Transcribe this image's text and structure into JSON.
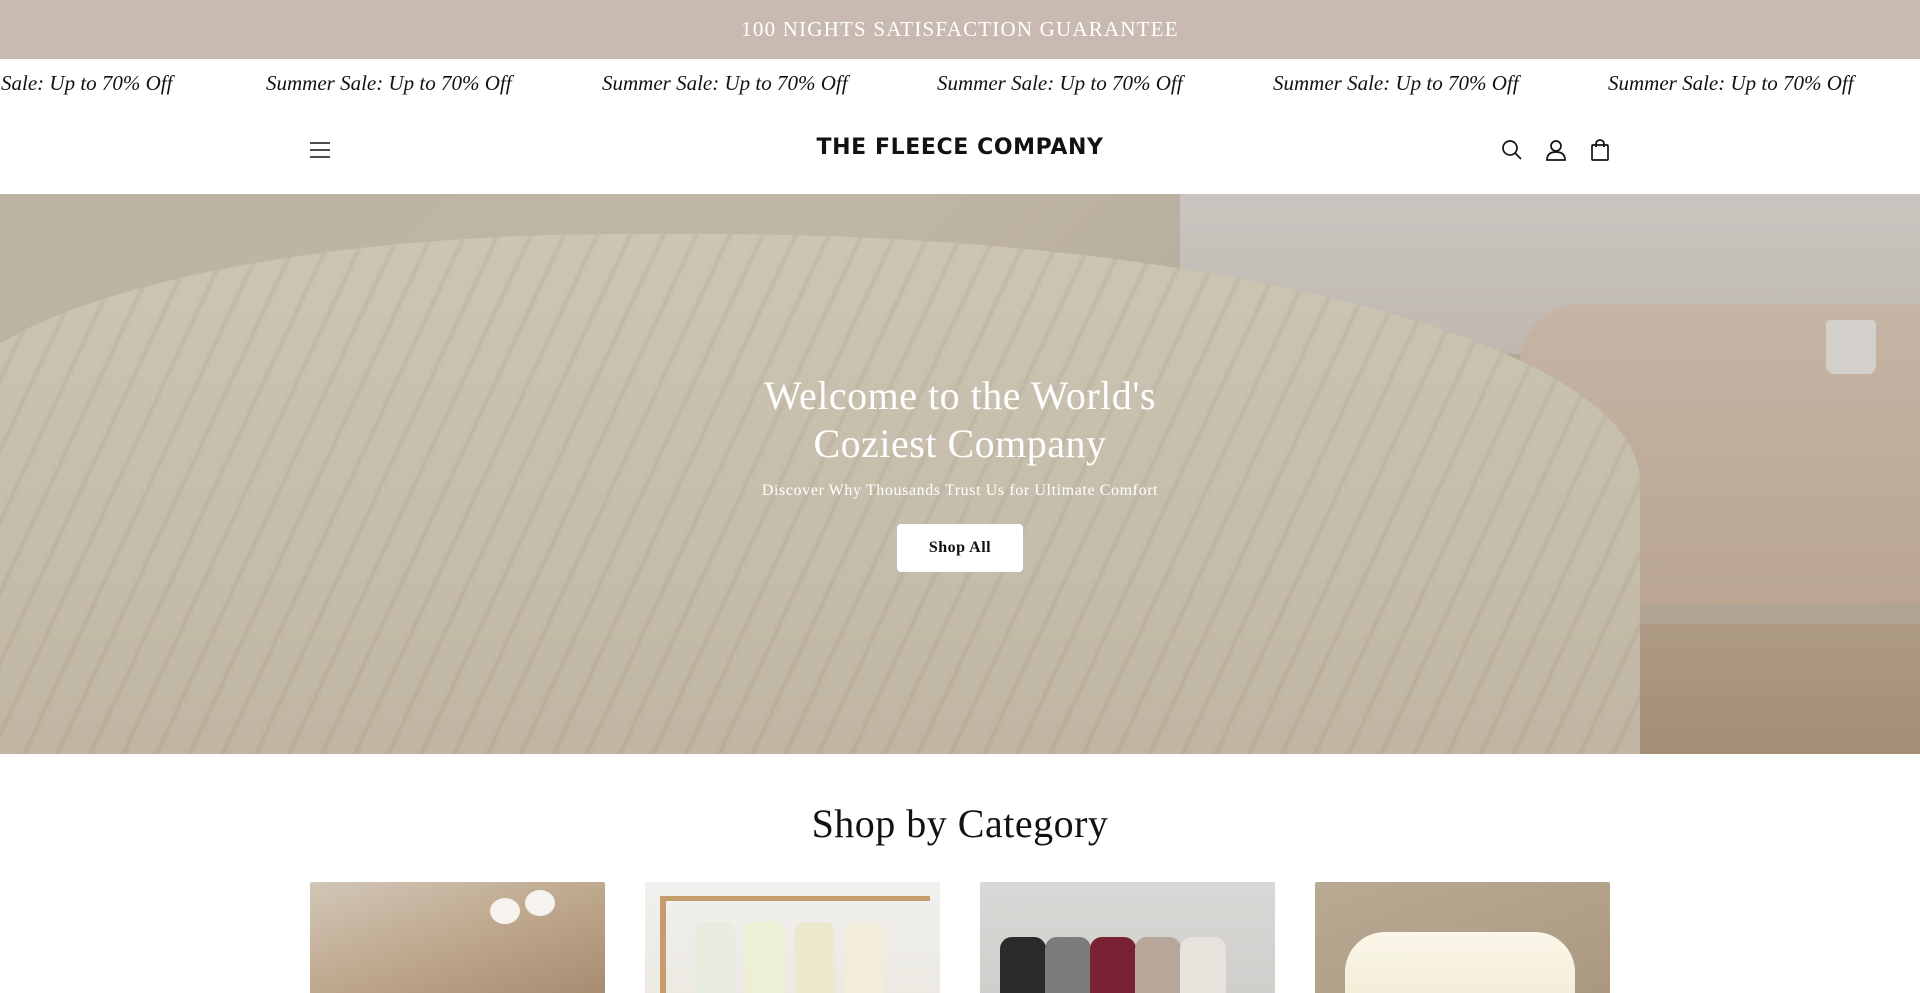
{
  "announcement": {
    "text": "100 NIGHTS SATISFACTION GUARANTEE"
  },
  "marquee": {
    "items": [
      "Sale: Up to 70% Off",
      "Summer Sale: Up to 70% Off",
      "Summer Sale: Up to 70% Off",
      "Summer Sale: Up to 70% Off",
      "Summer Sale: Up to 70% Off",
      "Summer Sale: Up to 70% Off"
    ]
  },
  "header": {
    "logo": "THE FLEECE COMPANY",
    "icons": [
      "menu-icon",
      "search-icon",
      "account-icon",
      "cart-icon"
    ]
  },
  "hero": {
    "title_line1": "Welcome to the World's",
    "title_line2": "Coziest Company",
    "subtitle": "Discover Why Thousands Trust Us for Ultimate Comfort",
    "cta_label": "Shop All"
  },
  "categories": {
    "title": "Shop by Category"
  },
  "colors": {
    "announcement_bg": "#c8bab0",
    "text": "#121212",
    "button_bg": "#ffffff"
  }
}
